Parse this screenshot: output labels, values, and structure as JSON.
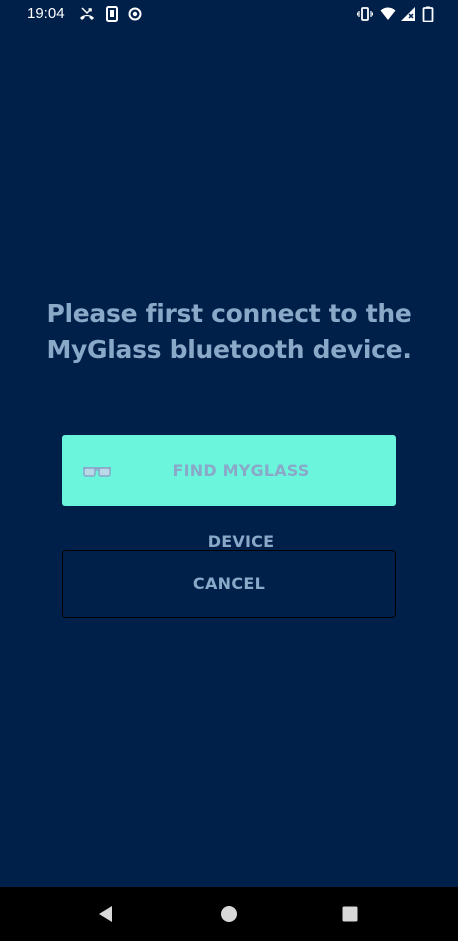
{
  "status_bar": {
    "time": "19:04",
    "left_icons": [
      "missed-call-icon",
      "sim-icon",
      "record-icon"
    ],
    "right_icons": [
      "vibrate-icon",
      "wifi-icon",
      "signal-icon",
      "battery-icon"
    ]
  },
  "main": {
    "message": "Please first connect to the MyGlass bluetooth device.",
    "find_button": {
      "label": "FIND MYGLASS DEVICE",
      "icon": "glasses-icon"
    },
    "cancel_button": {
      "label": "CANCEL"
    }
  },
  "navigation": {
    "buttons": [
      "back-icon",
      "home-icon",
      "recents-icon"
    ]
  },
  "colors": {
    "background": "#00204a",
    "accent": "#6bf5dc",
    "text": "#8aa8c8",
    "nav_bar": "#000000"
  }
}
